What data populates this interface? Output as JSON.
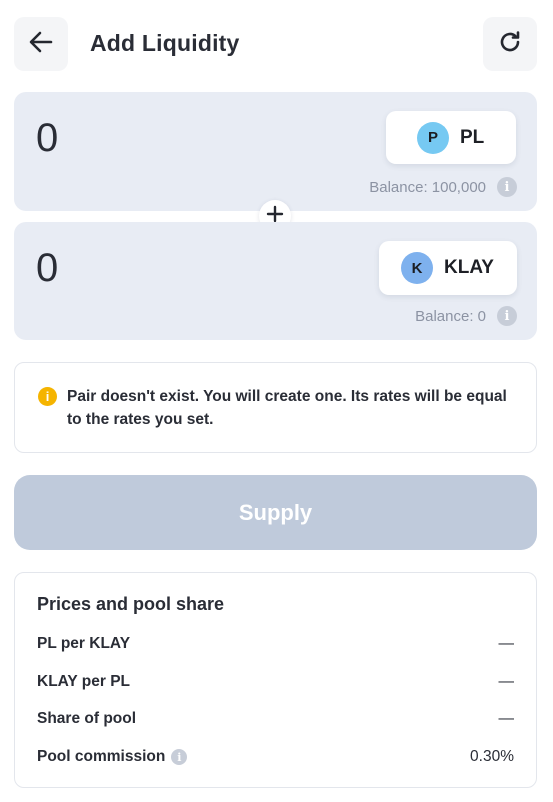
{
  "header": {
    "title": "Add Liquidity",
    "back_icon": "arrow-left-icon",
    "refresh_icon": "refresh-icon"
  },
  "token_a": {
    "amount": "0",
    "avatar_letter": "P",
    "symbol": "PL",
    "avatar_color": "#76c9f2",
    "balance": "Balance: 100,000"
  },
  "token_b": {
    "amount": "0",
    "avatar_letter": "K",
    "symbol": "KLAY",
    "avatar_color": "#7eb1ee",
    "balance": "Balance: 0"
  },
  "plus_icon": "plus-icon",
  "notice": {
    "icon": "warning-info-icon",
    "text": "Pair doesn't exist. You will create one. Its rates will be equal to the rates you set."
  },
  "supply": {
    "label": "Supply",
    "disabled": true
  },
  "prices": {
    "title": "Prices and pool share",
    "rows": [
      {
        "label": "PL per KLAY",
        "value": "—"
      },
      {
        "label": "KLAY per PL",
        "value": "—"
      },
      {
        "label": "Share of pool",
        "value": "—"
      },
      {
        "label": "Pool commission",
        "value": "0.30%"
      }
    ]
  },
  "colors": {
    "panel_bg": "#e8ecf4",
    "supply_disabled": "#bfcadb",
    "warning": "#f5b400",
    "muted_text": "#8c93a3"
  }
}
